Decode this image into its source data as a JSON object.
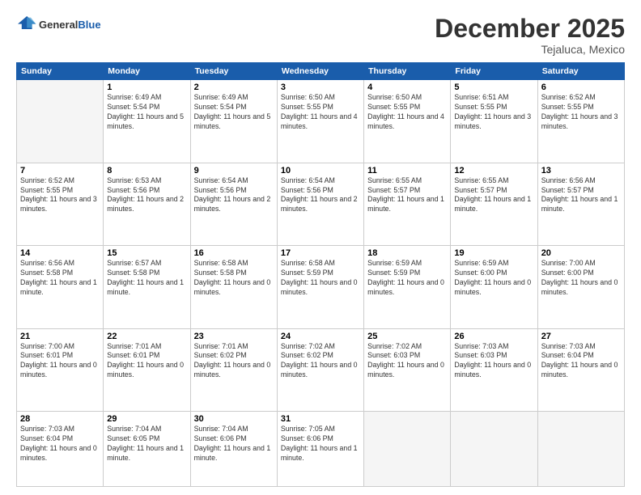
{
  "header": {
    "logo_general": "General",
    "logo_blue": "Blue",
    "month": "December 2025",
    "location": "Tejaluca, Mexico"
  },
  "days_of_week": [
    "Sunday",
    "Monday",
    "Tuesday",
    "Wednesday",
    "Thursday",
    "Friday",
    "Saturday"
  ],
  "weeks": [
    [
      {
        "num": "",
        "empty": true
      },
      {
        "num": "1",
        "sunrise": "Sunrise: 6:49 AM",
        "sunset": "Sunset: 5:54 PM",
        "daylight": "Daylight: 11 hours and 5 minutes."
      },
      {
        "num": "2",
        "sunrise": "Sunrise: 6:49 AM",
        "sunset": "Sunset: 5:54 PM",
        "daylight": "Daylight: 11 hours and 5 minutes."
      },
      {
        "num": "3",
        "sunrise": "Sunrise: 6:50 AM",
        "sunset": "Sunset: 5:55 PM",
        "daylight": "Daylight: 11 hours and 4 minutes."
      },
      {
        "num": "4",
        "sunrise": "Sunrise: 6:50 AM",
        "sunset": "Sunset: 5:55 PM",
        "daylight": "Daylight: 11 hours and 4 minutes."
      },
      {
        "num": "5",
        "sunrise": "Sunrise: 6:51 AM",
        "sunset": "Sunset: 5:55 PM",
        "daylight": "Daylight: 11 hours and 3 minutes."
      },
      {
        "num": "6",
        "sunrise": "Sunrise: 6:52 AM",
        "sunset": "Sunset: 5:55 PM",
        "daylight": "Daylight: 11 hours and 3 minutes."
      }
    ],
    [
      {
        "num": "7",
        "sunrise": "Sunrise: 6:52 AM",
        "sunset": "Sunset: 5:55 PM",
        "daylight": "Daylight: 11 hours and 3 minutes."
      },
      {
        "num": "8",
        "sunrise": "Sunrise: 6:53 AM",
        "sunset": "Sunset: 5:56 PM",
        "daylight": "Daylight: 11 hours and 2 minutes."
      },
      {
        "num": "9",
        "sunrise": "Sunrise: 6:54 AM",
        "sunset": "Sunset: 5:56 PM",
        "daylight": "Daylight: 11 hours and 2 minutes."
      },
      {
        "num": "10",
        "sunrise": "Sunrise: 6:54 AM",
        "sunset": "Sunset: 5:56 PM",
        "daylight": "Daylight: 11 hours and 2 minutes."
      },
      {
        "num": "11",
        "sunrise": "Sunrise: 6:55 AM",
        "sunset": "Sunset: 5:57 PM",
        "daylight": "Daylight: 11 hours and 1 minute."
      },
      {
        "num": "12",
        "sunrise": "Sunrise: 6:55 AM",
        "sunset": "Sunset: 5:57 PM",
        "daylight": "Daylight: 11 hours and 1 minute."
      },
      {
        "num": "13",
        "sunrise": "Sunrise: 6:56 AM",
        "sunset": "Sunset: 5:57 PM",
        "daylight": "Daylight: 11 hours and 1 minute."
      }
    ],
    [
      {
        "num": "14",
        "sunrise": "Sunrise: 6:56 AM",
        "sunset": "Sunset: 5:58 PM",
        "daylight": "Daylight: 11 hours and 1 minute."
      },
      {
        "num": "15",
        "sunrise": "Sunrise: 6:57 AM",
        "sunset": "Sunset: 5:58 PM",
        "daylight": "Daylight: 11 hours and 1 minute."
      },
      {
        "num": "16",
        "sunrise": "Sunrise: 6:58 AM",
        "sunset": "Sunset: 5:58 PM",
        "daylight": "Daylight: 11 hours and 0 minutes."
      },
      {
        "num": "17",
        "sunrise": "Sunrise: 6:58 AM",
        "sunset": "Sunset: 5:59 PM",
        "daylight": "Daylight: 11 hours and 0 minutes."
      },
      {
        "num": "18",
        "sunrise": "Sunrise: 6:59 AM",
        "sunset": "Sunset: 5:59 PM",
        "daylight": "Daylight: 11 hours and 0 minutes."
      },
      {
        "num": "19",
        "sunrise": "Sunrise: 6:59 AM",
        "sunset": "Sunset: 6:00 PM",
        "daylight": "Daylight: 11 hours and 0 minutes."
      },
      {
        "num": "20",
        "sunrise": "Sunrise: 7:00 AM",
        "sunset": "Sunset: 6:00 PM",
        "daylight": "Daylight: 11 hours and 0 minutes."
      }
    ],
    [
      {
        "num": "21",
        "sunrise": "Sunrise: 7:00 AM",
        "sunset": "Sunset: 6:01 PM",
        "daylight": "Daylight: 11 hours and 0 minutes."
      },
      {
        "num": "22",
        "sunrise": "Sunrise: 7:01 AM",
        "sunset": "Sunset: 6:01 PM",
        "daylight": "Daylight: 11 hours and 0 minutes."
      },
      {
        "num": "23",
        "sunrise": "Sunrise: 7:01 AM",
        "sunset": "Sunset: 6:02 PM",
        "daylight": "Daylight: 11 hours and 0 minutes."
      },
      {
        "num": "24",
        "sunrise": "Sunrise: 7:02 AM",
        "sunset": "Sunset: 6:02 PM",
        "daylight": "Daylight: 11 hours and 0 minutes."
      },
      {
        "num": "25",
        "sunrise": "Sunrise: 7:02 AM",
        "sunset": "Sunset: 6:03 PM",
        "daylight": "Daylight: 11 hours and 0 minutes."
      },
      {
        "num": "26",
        "sunrise": "Sunrise: 7:03 AM",
        "sunset": "Sunset: 6:03 PM",
        "daylight": "Daylight: 11 hours and 0 minutes."
      },
      {
        "num": "27",
        "sunrise": "Sunrise: 7:03 AM",
        "sunset": "Sunset: 6:04 PM",
        "daylight": "Daylight: 11 hours and 0 minutes."
      }
    ],
    [
      {
        "num": "28",
        "sunrise": "Sunrise: 7:03 AM",
        "sunset": "Sunset: 6:04 PM",
        "daylight": "Daylight: 11 hours and 0 minutes."
      },
      {
        "num": "29",
        "sunrise": "Sunrise: 7:04 AM",
        "sunset": "Sunset: 6:05 PM",
        "daylight": "Daylight: 11 hours and 1 minute."
      },
      {
        "num": "30",
        "sunrise": "Sunrise: 7:04 AM",
        "sunset": "Sunset: 6:06 PM",
        "daylight": "Daylight: 11 hours and 1 minute."
      },
      {
        "num": "31",
        "sunrise": "Sunrise: 7:05 AM",
        "sunset": "Sunset: 6:06 PM",
        "daylight": "Daylight: 11 hours and 1 minute."
      },
      {
        "num": "",
        "empty": true
      },
      {
        "num": "",
        "empty": true
      },
      {
        "num": "",
        "empty": true
      }
    ]
  ]
}
